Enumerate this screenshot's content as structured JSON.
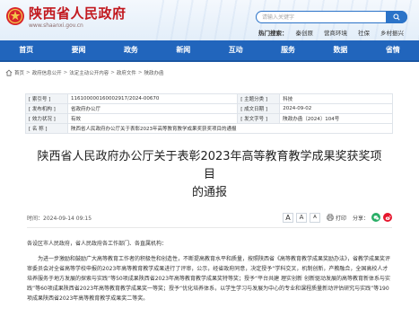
{
  "header": {
    "site_title": "陕西省人民政府",
    "site_url": "www.shaanxi.gov.cn",
    "search_placeholder": "请输入关键字",
    "hot_label": "热门搜索：",
    "hot_searches": [
      "秦创原",
      "营商环境",
      "社保",
      "乡村振兴"
    ]
  },
  "nav": [
    "首页",
    "要闻",
    "政务",
    "新闻",
    "互动",
    "服务",
    "数据",
    "省情"
  ],
  "breadcrumb": [
    "首页",
    "政府信息公开",
    "法定主动公开内容",
    "政府文件",
    "陕政办函"
  ],
  "meta": {
    "labels": [
      "[ 索引号 ]",
      "[ 发布机构 ]",
      "[ 效力状况 ]",
      "[ 名 称 ]",
      "[ 主题分类 ]",
      "[ 成文日期 ]",
      "[ 发文字号 ]"
    ],
    "index_no": "11610000016000291​7/2024-00670",
    "publisher": "省政府办公厅",
    "validity": "有效",
    "name": "陕西省人民政府办公厅关于表彰2023年高等教育教学成果奖获奖项目的通报",
    "topic": "科技",
    "written_date": "2024-09-02",
    "doc_no": "陕政办函〔2024〕104号"
  },
  "document": {
    "title_line1": "陕西省人民政府办公厅关于表彰2023年高等教育教学成果奖获奖项目",
    "title_line2": "的通报",
    "publish_time": "时间：2024-09-14 09:15",
    "font_large": "A",
    "font_medium": "A",
    "font_small": "A",
    "print_label": "打印",
    "share_label": "分享：",
    "salutation": "各设区市人民政府，省人民政府各工作部门、各直属机构：",
    "paragraph1": "为进一步激励和鼓励广大高等教育工作者的积极性和创造性，不断提高教育水平和质量，按照陕西省《高等教育教学成果奖励办法》，省教学成果奖评审委员会对全省高等学校申报的2023年高等教育教学成果进行了评审，公示，经省政府同意，决定授予“学科交叉，机制创新，产教融合，全国高校人才培养服务于地方发展的探索与实践”等50项成果陕西省2023年高等教育教学成果奖特等奖；授予“平台共建 理实创新 创新驱动发展的高等教育新体系与实践”等60项成果陕西省2023年高等教育教学成果奖一等奖；授予“优化培养体系，以学生学习与发展为中心的专业和课程质量新动评估研究与实践”等190项成果陕西省2023年高等教育教学成果奖二等奖。"
  },
  "colors": {
    "brand_red": "#c2191f",
    "nav_blue": "#2165bc",
    "search_blue": "#2b73c8",
    "wechat_green": "#2aae67",
    "weibo_red": "#e6162d"
  }
}
